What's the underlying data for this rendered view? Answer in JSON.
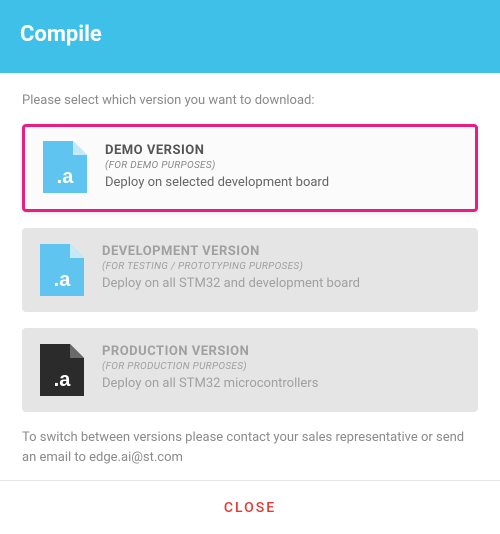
{
  "header": {
    "title": "Compile"
  },
  "prompt": "Please select which version you want to download:",
  "options": [
    {
      "title": "DEMO VERSION",
      "subtitle": "(FOR DEMO PURPOSES)",
      "description": "Deploy on selected development board",
      "icon_color": "#5fc4ef",
      "selected": true,
      "enabled": true
    },
    {
      "title": "DEVELOPMENT VERSION",
      "subtitle": "(FOR TESTING / PROTOTYPING PURPOSES)",
      "description": "Deploy on all STM32 and development board",
      "icon_color": "#5fc4ef",
      "selected": false,
      "enabled": false
    },
    {
      "title": "PRODUCTION VERSION",
      "subtitle": "(FOR PRODUCTION PURPOSES)",
      "description": "Deploy on all STM32 microcontrollers",
      "icon_color": "#2b2b2b",
      "selected": false,
      "enabled": false
    }
  ],
  "footer_note": "To switch between versions please contact your sales representative or send an email to edge.ai@st.com",
  "close_label": "CLOSE"
}
